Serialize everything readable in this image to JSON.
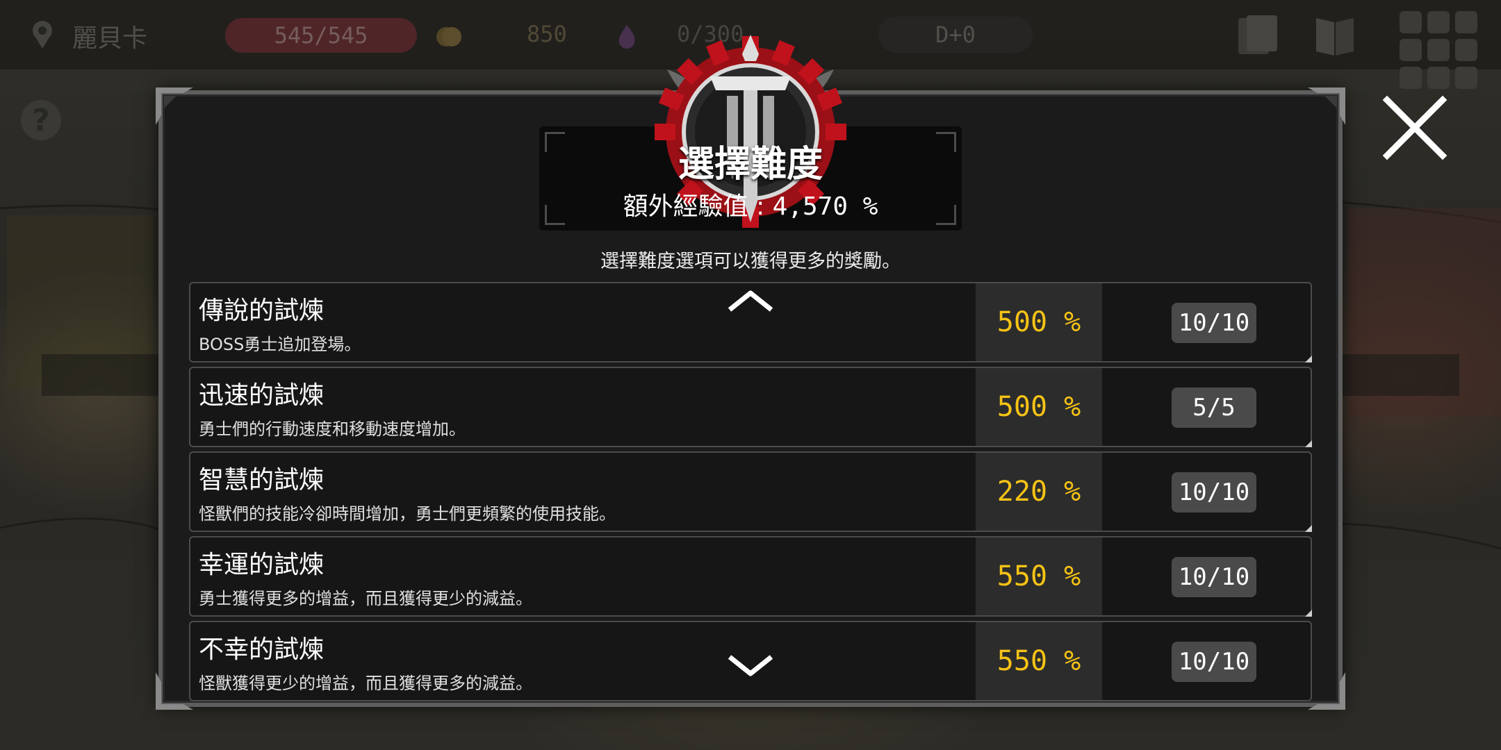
{
  "topbar": {
    "location": "麗貝卡",
    "hp": "545/545",
    "gold": "850",
    "souls": "0/300",
    "day": "D+0"
  },
  "modal": {
    "title": "選擇難度",
    "bonus_label": "額外經驗值 :",
    "bonus_value": "4,570 %",
    "description": "選擇難度選項可以獲得更多的獎勵。"
  },
  "trials": [
    {
      "name": "傳說的試煉",
      "desc": "BOSS勇士追加登場。",
      "bonus": "500 %",
      "level": "10/10"
    },
    {
      "name": "迅速的試煉",
      "desc": "勇士們的行動速度和移動速度增加。",
      "bonus": "500 %",
      "level": "5/5"
    },
    {
      "name": "智慧的試煉",
      "desc": "怪獸們的技能冷卻時間增加，勇士們更頻繁的使用技能。",
      "bonus": "220 %",
      "level": "10/10"
    },
    {
      "name": "幸運的試煉",
      "desc": "勇士獲得更多的增益，而且獲得更少的減益。",
      "bonus": "550 %",
      "level": "10/10"
    },
    {
      "name": "不幸的試煉",
      "desc": "怪獸獲得更少的增益，而且獲得更多的減益。",
      "bonus": "550 %",
      "level": "10/10"
    }
  ],
  "colors": {
    "bonus": "#f5c316",
    "emblem_red": "#c0121c",
    "hp_bar": "#7a3a3e"
  }
}
